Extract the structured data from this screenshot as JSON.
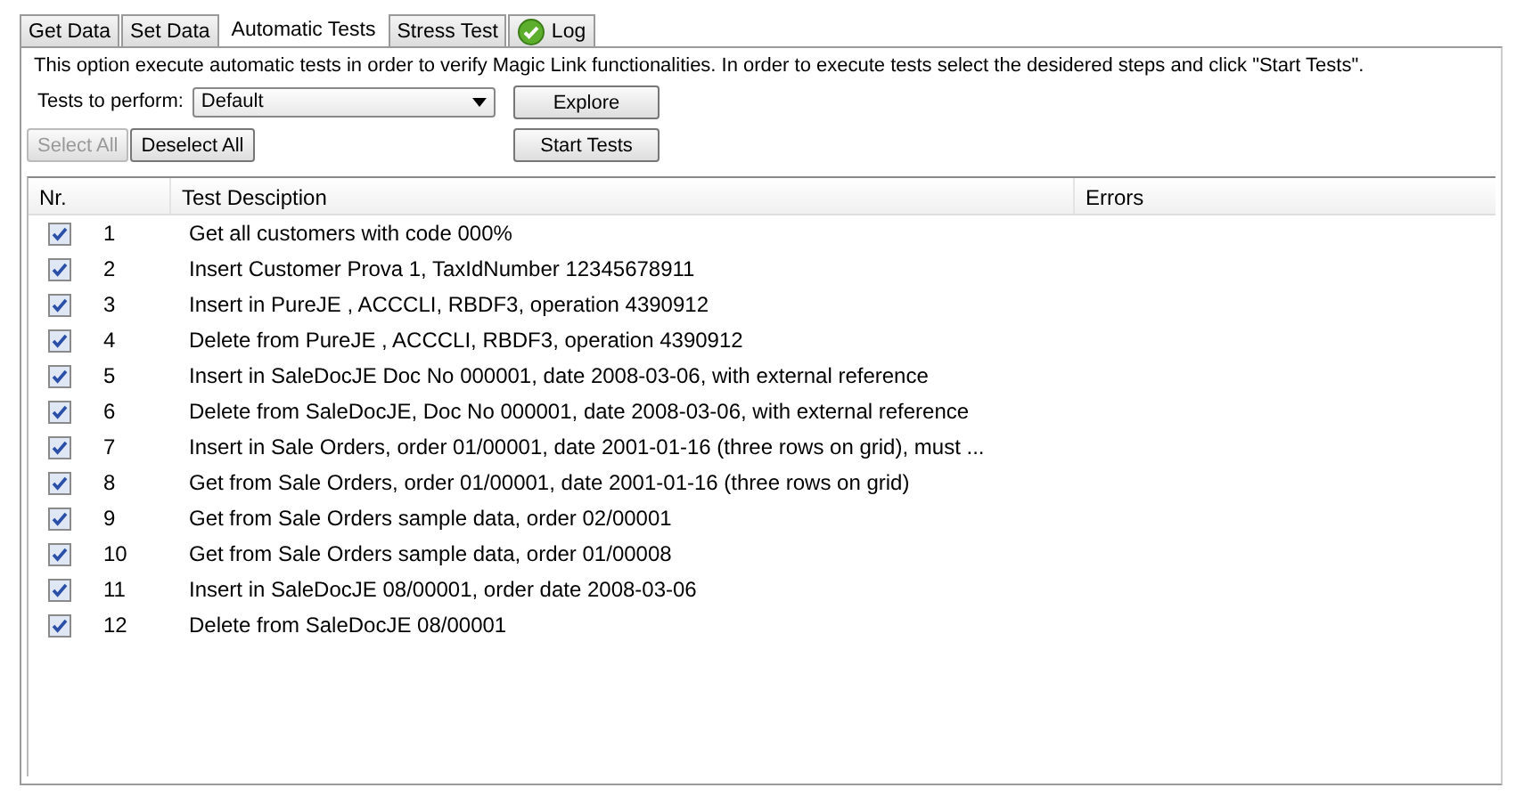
{
  "tabs": [
    {
      "label": "Get Data",
      "selected": false,
      "icon": false
    },
    {
      "label": "Set Data",
      "selected": false,
      "icon": false
    },
    {
      "label": "Automatic Tests",
      "selected": true,
      "icon": false
    },
    {
      "label": "Stress Test",
      "selected": false,
      "icon": false
    },
    {
      "label": "Log",
      "selected": false,
      "icon": true
    }
  ],
  "description": "This option execute automatic tests in order to verify Magic Link functionalities. In order to execute tests select the desidered steps and click \"Start Tests\".",
  "tests_select": {
    "label": "Tests to perform:",
    "value": "Default"
  },
  "buttons": {
    "explore": "Explore",
    "start": "Start Tests",
    "select_all": {
      "label": "Select All",
      "disabled": true
    },
    "deselect_all": {
      "label": "Deselect All",
      "disabled": false
    }
  },
  "table": {
    "columns": [
      "Nr.",
      "Test Desciption",
      "Errors"
    ],
    "rows": [
      {
        "checked": true,
        "nr": "1",
        "description": "Get all customers with code 000%"
      },
      {
        "checked": true,
        "nr": "2",
        "description": "Insert Customer Prova 1, TaxIdNumber 12345678911"
      },
      {
        "checked": true,
        "nr": "3",
        "description": "Insert in PureJE , ACCCLI, RBDF3, operation 4390912"
      },
      {
        "checked": true,
        "nr": "4",
        "description": "Delete from PureJE , ACCCLI, RBDF3, operation 4390912"
      },
      {
        "checked": true,
        "nr": "5",
        "description": "Insert in SaleDocJE Doc No 000001, date 2008-03-06, with external reference"
      },
      {
        "checked": true,
        "nr": "6",
        "description": "Delete from SaleDocJE, Doc No 000001, date 2008-03-06, with external reference"
      },
      {
        "checked": true,
        "nr": "7",
        "description": "Insert in Sale Orders, order 01/00001, date 2001-01-16 (three rows on grid), must ..."
      },
      {
        "checked": true,
        "nr": "8",
        "description": "Get from Sale Orders, order 01/00001, date 2001-01-16 (three rows on grid)"
      },
      {
        "checked": true,
        "nr": "9",
        "description": "Get from Sale Orders sample data, order 02/00001"
      },
      {
        "checked": true,
        "nr": "10",
        "description": "Get from Sale Orders sample data, order 01/00008"
      },
      {
        "checked": true,
        "nr": "11",
        "description": "Insert in SaleDocJE 08/00001, order date 2008-03-06"
      },
      {
        "checked": true,
        "nr": "12",
        "description": "Delete from SaleDocJE 08/00001"
      }
    ]
  }
}
